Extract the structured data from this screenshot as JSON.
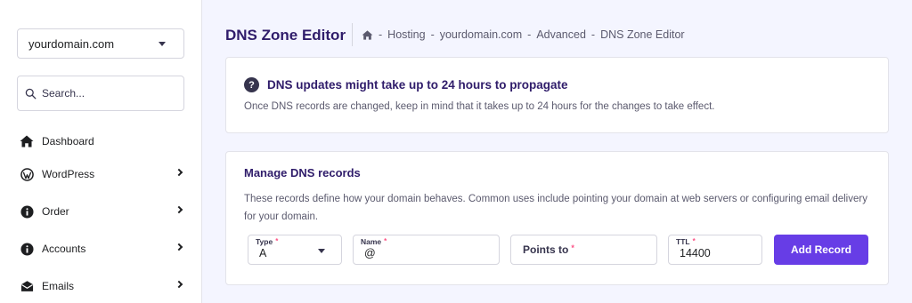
{
  "sidebar": {
    "domain_select": {
      "value": "yourdomain.com"
    },
    "search": {
      "placeholder": "Search..."
    },
    "items": [
      {
        "label": "Dashboard",
        "icon": "home-icon",
        "has_chevron": false
      },
      {
        "label": "WordPress",
        "icon": "wordpress-icon",
        "has_chevron": true
      },
      {
        "label": "Order",
        "icon": "info-icon",
        "has_chevron": true
      },
      {
        "label": "Accounts",
        "icon": "info-icon",
        "has_chevron": true
      },
      {
        "label": "Emails",
        "icon": "envelope-icon",
        "has_chevron": true
      }
    ]
  },
  "header": {
    "title": "DNS Zone Editor",
    "breadcrumb": {
      "home_icon": "home-icon",
      "separator": "-",
      "items": [
        "Hosting",
        "yourdomain.com",
        "Advanced",
        "DNS Zone Editor"
      ]
    }
  },
  "notice": {
    "icon": "question-circle-icon",
    "title": "DNS updates might take up to 24 hours to propagate",
    "description": "Once DNS records are changed, keep in mind that it takes up to 24 hours for the changes to take effect."
  },
  "manage": {
    "title": "Manage DNS records",
    "description": "These records define how your domain behaves. Common uses include pointing your domain at web servers or configuring email delivery for your domain.",
    "form": {
      "type": {
        "label": "Type",
        "value": "A",
        "required_mark": "*"
      },
      "name": {
        "label": "Name",
        "value": "@",
        "required_mark": "*"
      },
      "points_to": {
        "label": "Points to",
        "value": "",
        "required_mark": "*"
      },
      "ttl": {
        "label": "TTL",
        "value": "14400",
        "required_mark": "*"
      },
      "submit_label": "Add Record"
    }
  },
  "colors": {
    "accent": "#673de6",
    "title": "#2f1c6a",
    "background": "#f4f5ff",
    "required": "#fc5185"
  }
}
